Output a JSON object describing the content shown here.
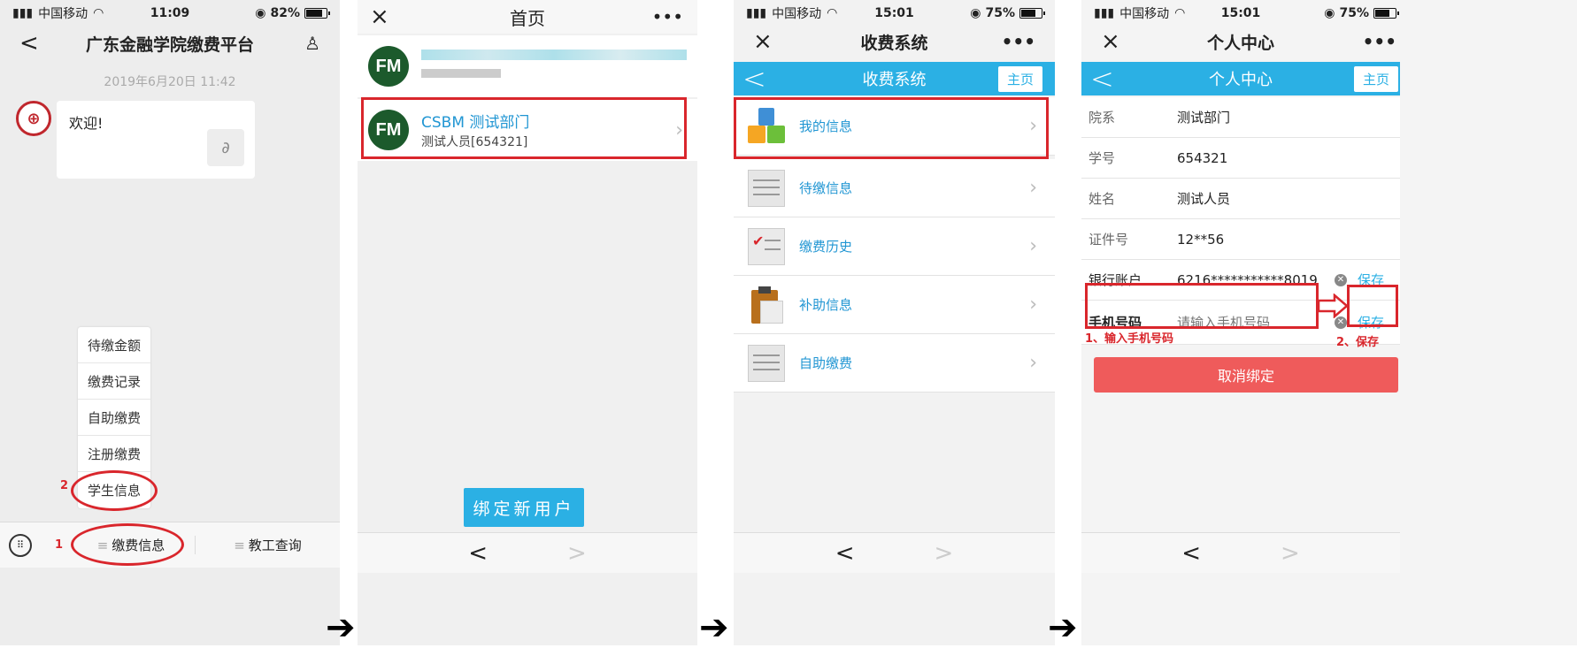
{
  "panel1": {
    "status": {
      "carrier": "中国移动",
      "time": "11:09",
      "battery": "82%",
      "battery_level": 0.82
    },
    "nav": {
      "back": "<",
      "title": "广东金融学院缴费平台"
    },
    "date": "2019年6月20日 11:42",
    "message": "欢迎!",
    "popup_items": [
      "待缴金额",
      "缴费记录",
      "自助缴费",
      "注册缴费",
      "学生信息"
    ],
    "step_1": "1",
    "step_2": "2",
    "tab_pay": "缴费信息",
    "tab_query": "教工查询"
  },
  "panel2": {
    "nav": {
      "close": "×",
      "title": "首页",
      "more": "•••"
    },
    "account": {
      "logo": "FM",
      "name": "CSBM 测试部门",
      "sub": "测试人员[654321]"
    },
    "bind_button": "绑定新用户",
    "back": "<",
    "forward": ">"
  },
  "panel3": {
    "status": {
      "carrier": "中国移动",
      "time": "15:01",
      "battery": "75%",
      "battery_level": 0.75
    },
    "nav": {
      "close": "×",
      "title": "收费系统",
      "more": "•••"
    },
    "bluebar": {
      "back": "<",
      "title": "收费系统",
      "home": "主页"
    },
    "items": [
      "我的信息",
      "待缴信息",
      "缴费历史",
      "补助信息",
      "自助缴费"
    ],
    "back": "<",
    "forward": ">"
  },
  "panel4": {
    "status": {
      "carrier": "中国移动",
      "time": "15:01",
      "battery": "75%",
      "battery_level": 0.75
    },
    "nav": {
      "close": "×",
      "title": "个人中心",
      "more": "•••"
    },
    "bluebar": {
      "back": "<",
      "title": "个人中心",
      "home": "主页"
    },
    "fields": [
      {
        "key": "院系",
        "value": "测试部门"
      },
      {
        "key": "学号",
        "value": "654321"
      },
      {
        "key": "姓名",
        "value": "测试人员"
      },
      {
        "key": "证件号",
        "value": "12**56"
      },
      {
        "key": "银行账户",
        "value": "6216***********8019"
      }
    ],
    "save_label": "保存",
    "phone_label": "手机号码",
    "phone_placeholder": "请输入手机号码",
    "step_1": "1、输入手机号码",
    "step_2": "2、保存",
    "cancel_button": "取消绑定",
    "back": "<",
    "forward": ">"
  },
  "arrow": "➔",
  "colors": {
    "accent_blue": "#2bb0e4",
    "link_blue": "#2196d3",
    "annotation_red": "#d9262c",
    "cancel_red": "#ef5b5b",
    "fm_green": "#1c5a2c"
  }
}
